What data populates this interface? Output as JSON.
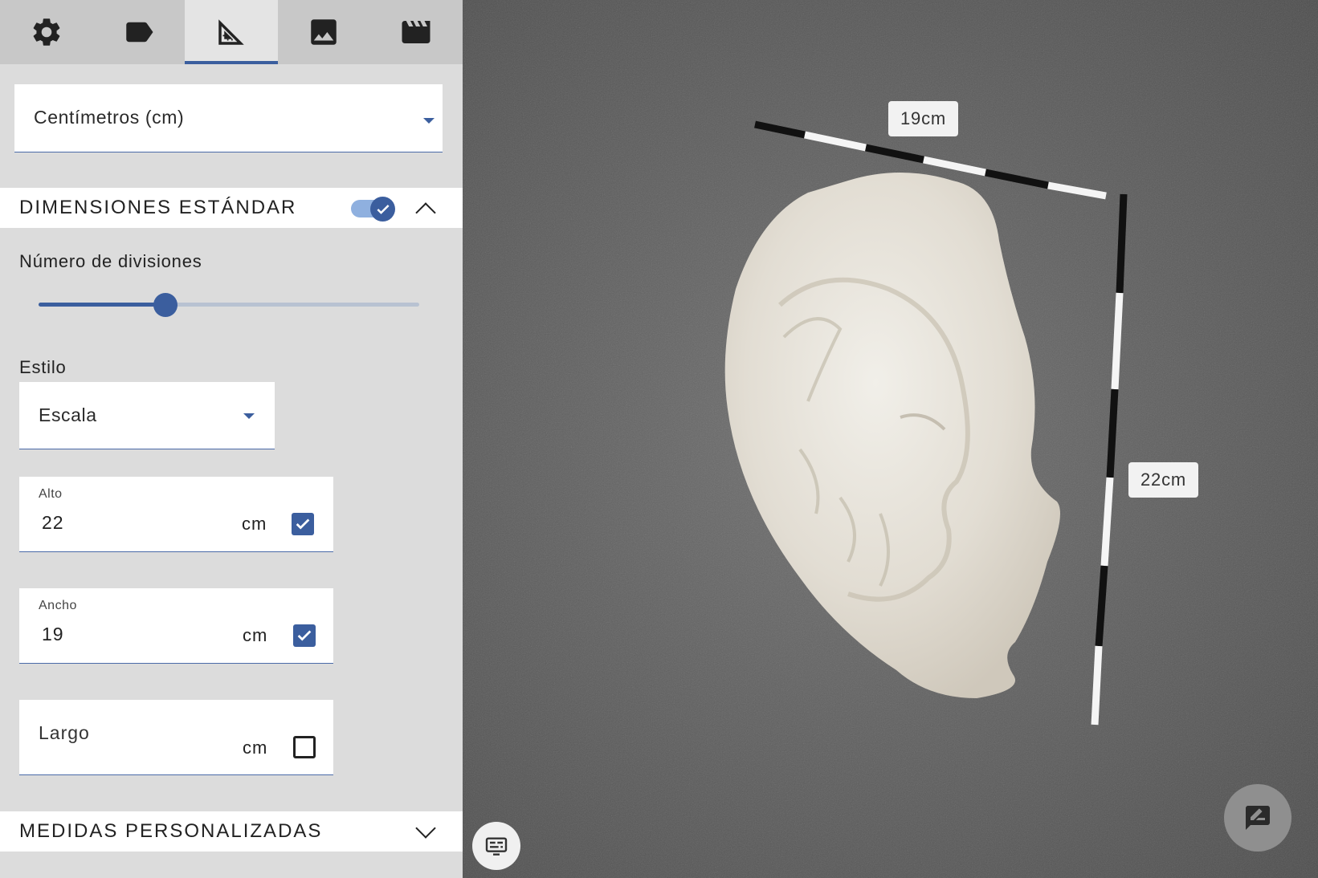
{
  "tabs": [
    {
      "icon": "gear-icon",
      "active": false
    },
    {
      "icon": "label-tag-icon",
      "active": false
    },
    {
      "icon": "ruler-triangle-icon",
      "active": true
    },
    {
      "icon": "image-icon",
      "active": false
    },
    {
      "icon": "clapperboard-icon",
      "active": false
    }
  ],
  "units": {
    "selected": "Centímetros (cm)"
  },
  "standard_dimensions": {
    "title": "DIMENSIONES ESTÁNDAR",
    "enabled": true,
    "expanded": true,
    "divisions_label": "Número de divisiones",
    "divisions_fraction": 0.33,
    "style_label": "Estilo",
    "style_selected": "Escala",
    "fields": {
      "height": {
        "label": "Alto",
        "value": "22",
        "unit": "cm",
        "checked": true
      },
      "width": {
        "label": "Ancho",
        "value": "19",
        "unit": "cm",
        "checked": true
      },
      "length": {
        "label": "Largo",
        "value": "",
        "unit": "cm",
        "checked": false
      }
    }
  },
  "custom_measures": {
    "title": "MEDIDAS PERSONALIZADAS",
    "expanded": false
  },
  "viewer": {
    "width_measure": "19cm",
    "height_measure": "22cm"
  },
  "colors": {
    "accent": "#3b5e9e",
    "toggle_track": "#8fb0df",
    "panel_bg": "#dcdcdc"
  }
}
